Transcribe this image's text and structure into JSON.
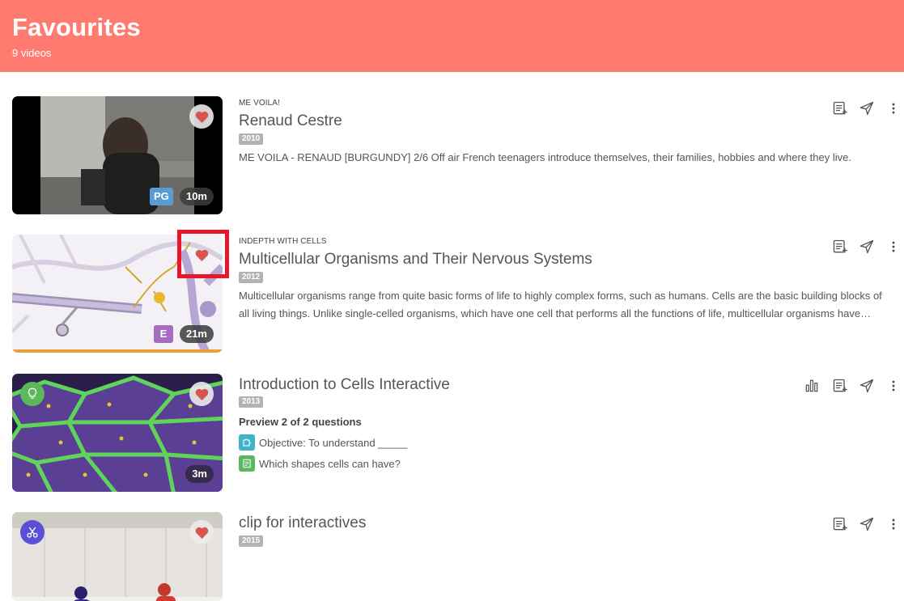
{
  "header": {
    "title": "Favourites",
    "count": "9 videos"
  },
  "videos": [
    {
      "series": "ME VOILA!",
      "title": "Renaud Cestre",
      "year": "2010",
      "description": "ME VOILA - RENAUD [BURGUNDY] 2/6 Off air French teenagers introduce themselves, their families, hobbies and where they live.",
      "rating": "PG",
      "duration": "10m"
    },
    {
      "series": "INDEPTH WITH CELLS",
      "title": "Multicellular Organisms and Their Nervous Systems",
      "year": "2012",
      "description": "Multicellular organisms range from quite basic forms of life to highly complex forms, such as humans. Cells are the basic building blocks of all living things. Unlike single-celled organisms, which have one cell that performs all the functions of life, multicellular organisms have specialised cells.",
      "rating": "E",
      "duration": "21m",
      "watch_progress": 1.0
    },
    {
      "title": "Introduction to Cells Interactive",
      "year": "2013",
      "duration": "3m",
      "preview_title": "Preview 2 of 2 questions",
      "questions": [
        "Objective: To understand _____",
        "Which shapes cells can have?"
      ]
    },
    {
      "title": "clip for interactives",
      "year": "2015"
    }
  ],
  "colors": {
    "header_bg": "#ff7b70",
    "heart": "#d9534f",
    "rating_pg": "#5b9bd5",
    "rating_e": "#a56cc1",
    "progress": "#e8a13a",
    "highlight": "#e8162a"
  },
  "icons": {
    "favourite": "heart-icon",
    "add_to_playlist": "playlist-add-icon",
    "share": "send-icon",
    "more": "more-vertical-icon",
    "stats": "bar-chart-icon",
    "interactive": "lightbulb-icon",
    "clip": "scissors-icon",
    "question_objective": "puzzle-icon",
    "question_text": "document-icon"
  }
}
